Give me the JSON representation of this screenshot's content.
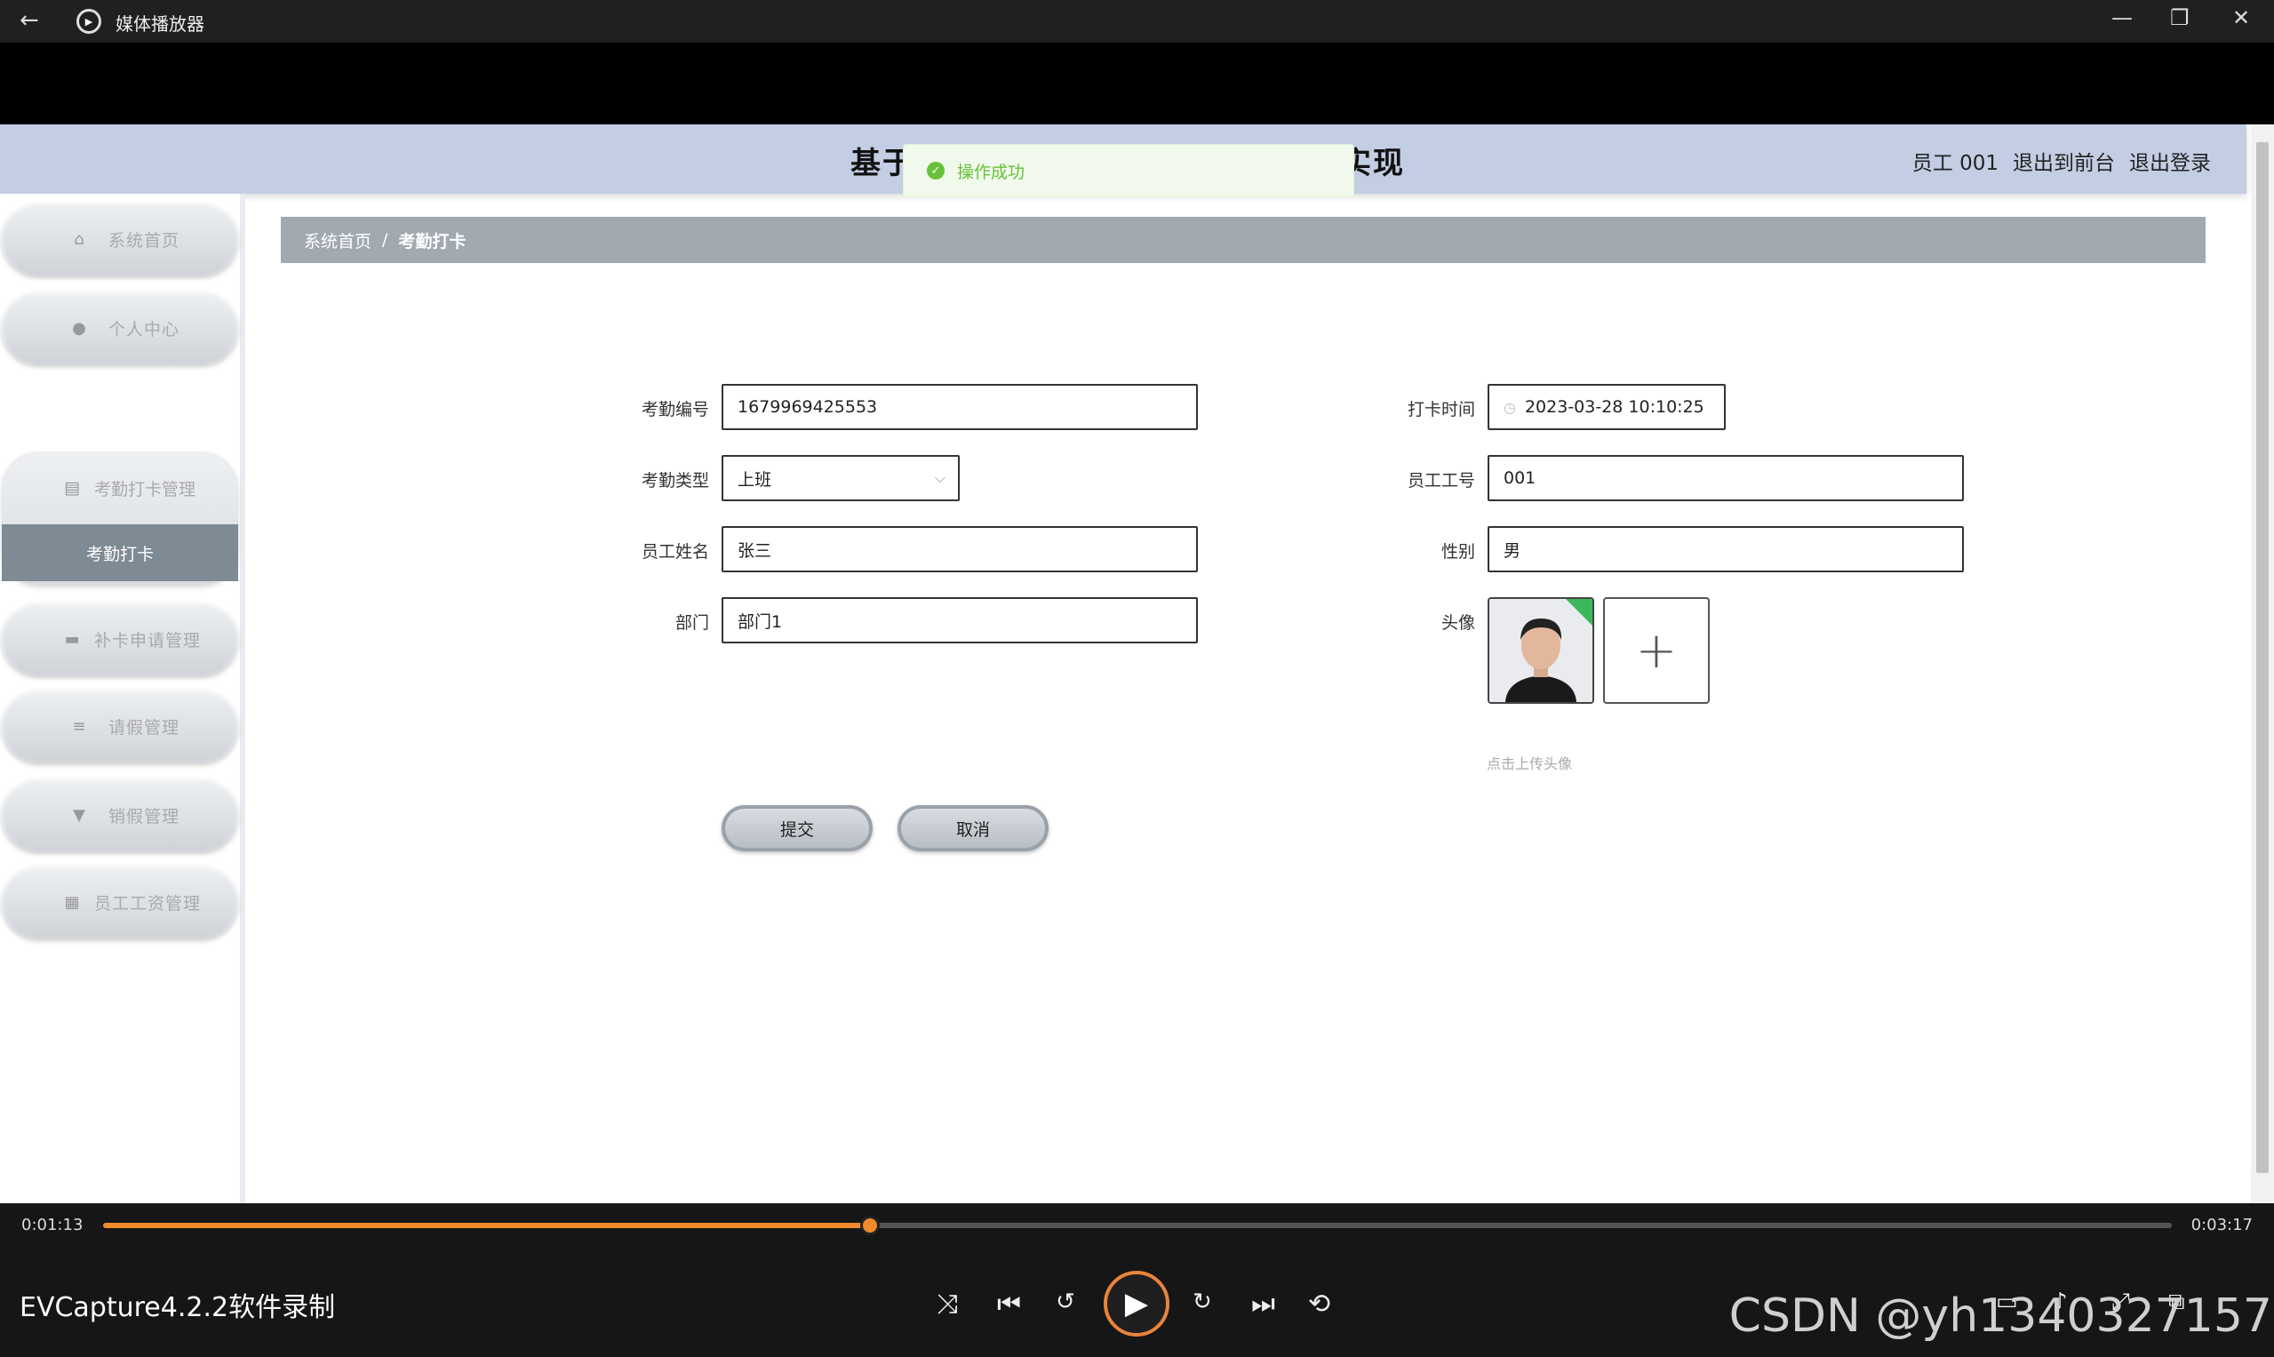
{
  "window": {
    "title": "媒体播放器",
    "back_icon": "←",
    "min_icon": "—",
    "restore_icon": "❐",
    "close_icon": "✕"
  },
  "header": {
    "title_visible_start": "基于",
    "title_visible_end": "实现",
    "user": "员工 001",
    "link_front": "退出到前台",
    "link_logout": "退出登录"
  },
  "toast": {
    "message": "操作成功",
    "color": "#67c23a"
  },
  "sidebar": {
    "items": [
      {
        "label": "系统首页",
        "icon": "home-icon",
        "glyph": "⌂"
      },
      {
        "label": "个人中心",
        "icon": "user-icon",
        "glyph": "●"
      },
      {
        "label": "考勤打卡管理",
        "icon": "clipboard-icon",
        "glyph": "▤"
      },
      {
        "label": "补卡申请管理",
        "icon": "monitor-icon",
        "glyph": "▬"
      },
      {
        "label": "请假管理",
        "icon": "list-icon",
        "glyph": "≡"
      },
      {
        "label": "销假管理",
        "icon": "signpost-icon",
        "glyph": "▼"
      },
      {
        "label": "员工工资管理",
        "icon": "grid-icon",
        "glyph": "▦"
      }
    ],
    "active_sub": "考勤打卡"
  },
  "breadcrumb": {
    "home": "系统首页",
    "sep": "/",
    "current": "考勤打卡"
  },
  "form": {
    "kqbh_label": "考勤编号",
    "kqbh_value": "1679969425553",
    "kqlx_label": "考勤类型",
    "kqlx_value": "上班",
    "ygxm_label": "员工姓名",
    "ygxm_value": "张三",
    "bm_label": "部门",
    "bm_value": "部门1",
    "dksj_label": "打卡时间",
    "dksj_value": "2023-03-28 10:10:25",
    "yggh_label": "员工工号",
    "yggh_value": "001",
    "xb_label": "性别",
    "xb_value": "男",
    "tx_label": "头像",
    "upload_hint": "点击上传头像",
    "submit": "提交",
    "cancel": "取消"
  },
  "player": {
    "current_time": "0:01:13",
    "total_time": "0:03:17",
    "progress_fraction": 0.3706,
    "recorder_text": "EVCapture4.2.2软件录制",
    "watermark": "CSDN @yh1340327157",
    "accent": "#f08a2c"
  }
}
